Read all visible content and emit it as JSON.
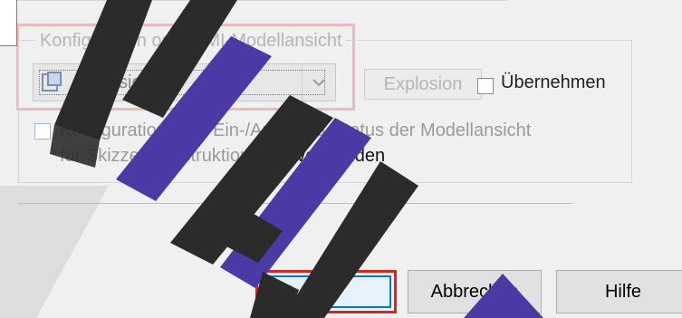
{
  "group": {
    "label": "Konfiguration oder PMI-Modellansicht",
    "combo_value": "Explosion",
    "combo_icon": "configuration-icon",
    "disabled_button_label": "Explosion",
    "apply_label": "Übernehmen",
    "apply_checked": false,
    "use_checked": false,
    "use_label_faded": "Konfiguration oder Ein-/Ausblendestatus der Modellansicht für Skizze, Konstruktion usw.",
    "use_label_dark": "verwenden"
  },
  "buttons": {
    "ok": "OK",
    "cancel": "Abbrechen",
    "help": "Hilfe"
  },
  "colors": {
    "highlight": "#d9261c",
    "focus": "#0078d7",
    "watermark_dark": "#333333",
    "watermark_purple": "#4b3aa8"
  },
  "watermark_letters": "U H"
}
